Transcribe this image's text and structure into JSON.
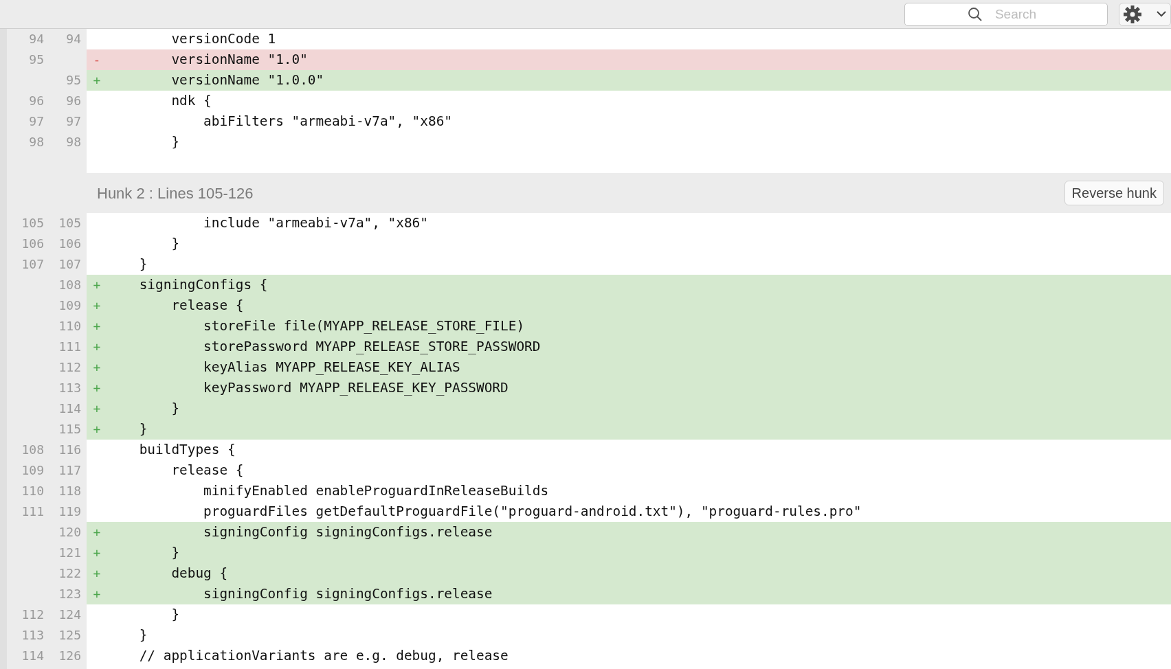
{
  "toolbar": {
    "search": {
      "placeholder": "Search"
    }
  },
  "rows": [
    {
      "kind": "context",
      "old": "94",
      "new": "94",
      "text": "        versionCode 1"
    },
    {
      "kind": "removed",
      "old": "95",
      "marker": "-",
      "text": "        versionName \"1.0\""
    },
    {
      "kind": "added",
      "new": "95",
      "marker": "+",
      "text": "        versionName \"1.0.0\""
    },
    {
      "kind": "context",
      "old": "96",
      "new": "96",
      "text": "        ndk {"
    },
    {
      "kind": "context",
      "old": "97",
      "new": "97",
      "text": "            abiFilters \"armeabi-v7a\", \"x86\""
    },
    {
      "kind": "context",
      "old": "98",
      "new": "98",
      "text": "        }"
    },
    {
      "kind": "spacer"
    },
    {
      "kind": "hunk",
      "title": "Hunk 2 : Lines 105-126",
      "button": "Reverse hunk"
    },
    {
      "kind": "context",
      "old": "105",
      "new": "105",
      "text": "            include \"armeabi-v7a\", \"x86\""
    },
    {
      "kind": "context",
      "old": "106",
      "new": "106",
      "text": "        }"
    },
    {
      "kind": "context",
      "old": "107",
      "new": "107",
      "text": "    }"
    },
    {
      "kind": "added",
      "new": "108",
      "marker": "+",
      "text": "    signingConfigs {"
    },
    {
      "kind": "added",
      "new": "109",
      "marker": "+",
      "text": "        release {"
    },
    {
      "kind": "added",
      "new": "110",
      "marker": "+",
      "text": "            storeFile file(MYAPP_RELEASE_STORE_FILE)"
    },
    {
      "kind": "added",
      "new": "111",
      "marker": "+",
      "text": "            storePassword MYAPP_RELEASE_STORE_PASSWORD"
    },
    {
      "kind": "added",
      "new": "112",
      "marker": "+",
      "text": "            keyAlias MYAPP_RELEASE_KEY_ALIAS"
    },
    {
      "kind": "added",
      "new": "113",
      "marker": "+",
      "text": "            keyPassword MYAPP_RELEASE_KEY_PASSWORD"
    },
    {
      "kind": "added",
      "new": "114",
      "marker": "+",
      "text": "        }"
    },
    {
      "kind": "added",
      "new": "115",
      "marker": "+",
      "text": "    }"
    },
    {
      "kind": "context",
      "old": "108",
      "new": "116",
      "text": "    buildTypes {"
    },
    {
      "kind": "context",
      "old": "109",
      "new": "117",
      "text": "        release {"
    },
    {
      "kind": "context",
      "old": "110",
      "new": "118",
      "text": "            minifyEnabled enableProguardInReleaseBuilds"
    },
    {
      "kind": "context",
      "old": "111",
      "new": "119",
      "text": "            proguardFiles getDefaultProguardFile(\"proguard-android.txt\"), \"proguard-rules.pro\""
    },
    {
      "kind": "added",
      "new": "120",
      "marker": "+",
      "text": "            signingConfig signingConfigs.release"
    },
    {
      "kind": "added",
      "new": "121",
      "marker": "+",
      "text": "        }"
    },
    {
      "kind": "added",
      "new": "122",
      "marker": "+",
      "text": "        debug {"
    },
    {
      "kind": "added",
      "new": "123",
      "marker": "+",
      "text": "            signingConfig signingConfigs.release"
    },
    {
      "kind": "context",
      "old": "112",
      "new": "124",
      "text": "        }"
    },
    {
      "kind": "context",
      "old": "113",
      "new": "125",
      "text": "    }"
    },
    {
      "kind": "context",
      "old": "114",
      "new": "126",
      "text": "    // applicationVariants are e.g. debug, release"
    }
  ]
}
